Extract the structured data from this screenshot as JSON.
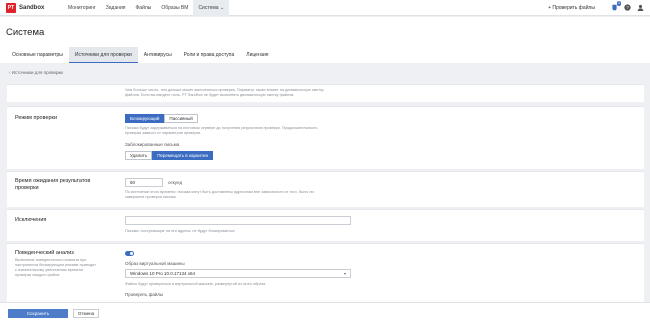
{
  "topbar": {
    "logo": "PT",
    "app_name": "Sandbox",
    "nav": [
      "Мониторинг",
      "Задания",
      "Файлы",
      "Образы ВМ",
      "Система ⌄"
    ],
    "check_files": "+ Проверить файлы",
    "notif_count": "3"
  },
  "page": {
    "title": "Система",
    "tabs": [
      "Основные параметры",
      "Источники для проверки",
      "Антивирусы",
      "Роли и права доступа",
      "Лицензия"
    ],
    "breadcrumb": "‹ Источники для проверки"
  },
  "top_help": {
    "line1": "Чем больше число, тем дольше может выполняться проверка. Параметр также влияет на динамическую сметку",
    "line2": "файлов. Если вы введете ноль, PT Sandbox не будет выполнять динамическую сметку файлов."
  },
  "mode": {
    "title": "Режим проверки",
    "btn_block": "Блокирующий",
    "btn_passive": "Пассивный",
    "help1": "Письма будут задерживаться на почтовом сервере до получения результатов проверки. Продолжительность",
    "help2": "проверки зависит от параметров проверки.",
    "blocked_label": "Заблокированные письма",
    "btn_delete": "Удалить",
    "btn_quarantine": "Перемещать в карантин"
  },
  "timeout": {
    "title_line1": "Время ожидания результатов",
    "title_line2": "проверки",
    "value": "60",
    "unit": "секунд",
    "help1": "По истечении этого времени, письма могут быть доставлены адресатам вне зависимости от того, было ли",
    "help2": "завершена проверка письма"
  },
  "exceptions": {
    "title": "Исключения",
    "help": "Письма, поступающие на эти адреса, не будут блокироваться"
  },
  "behavior": {
    "title": "Поведенческий анализ",
    "desc1": "Включение поведенческого анализа при",
    "desc2": "настроенном блокирующем режиме приводит",
    "desc3": "к значительному увеличению времени",
    "desc4": "проверки каждого файла.",
    "vm_label": "Образ виртуальной машины",
    "vm_value": "Windows 10 Pro 10.0.17134 x64",
    "vm_help": "Файлы будут проверяться в виртуальной машине, развернутой из этого образа",
    "check_files": "Проверять файлы"
  },
  "footer": {
    "save": "Сохранить",
    "cancel": "Отмена"
  }
}
